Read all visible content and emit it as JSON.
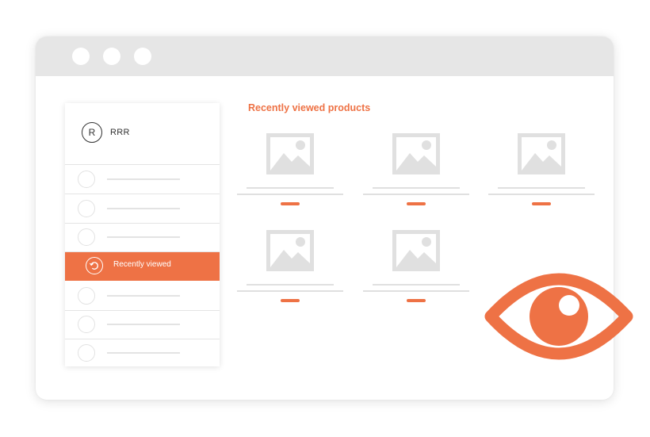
{
  "colors": {
    "accent": "#ee7245",
    "titlebar": "#e6e6e6",
    "placeholder": "#e0e0e0"
  },
  "window": {
    "controls": [
      "window-dot-icon",
      "window-dot-icon",
      "window-dot-icon"
    ]
  },
  "sidebar": {
    "profile": {
      "avatar_initial": "R",
      "name": "RRR"
    },
    "active_item": {
      "label": "Recently viewed",
      "icon": "history-icon"
    }
  },
  "main": {
    "title": "Recently viewed products",
    "products": [
      {
        "image_icon": "image-placeholder-icon"
      },
      {
        "image_icon": "image-placeholder-icon"
      },
      {
        "image_icon": "image-placeholder-icon"
      },
      {
        "image_icon": "image-placeholder-icon"
      },
      {
        "image_icon": "image-placeholder-icon"
      }
    ]
  },
  "overlay_icon": "eye-icon"
}
